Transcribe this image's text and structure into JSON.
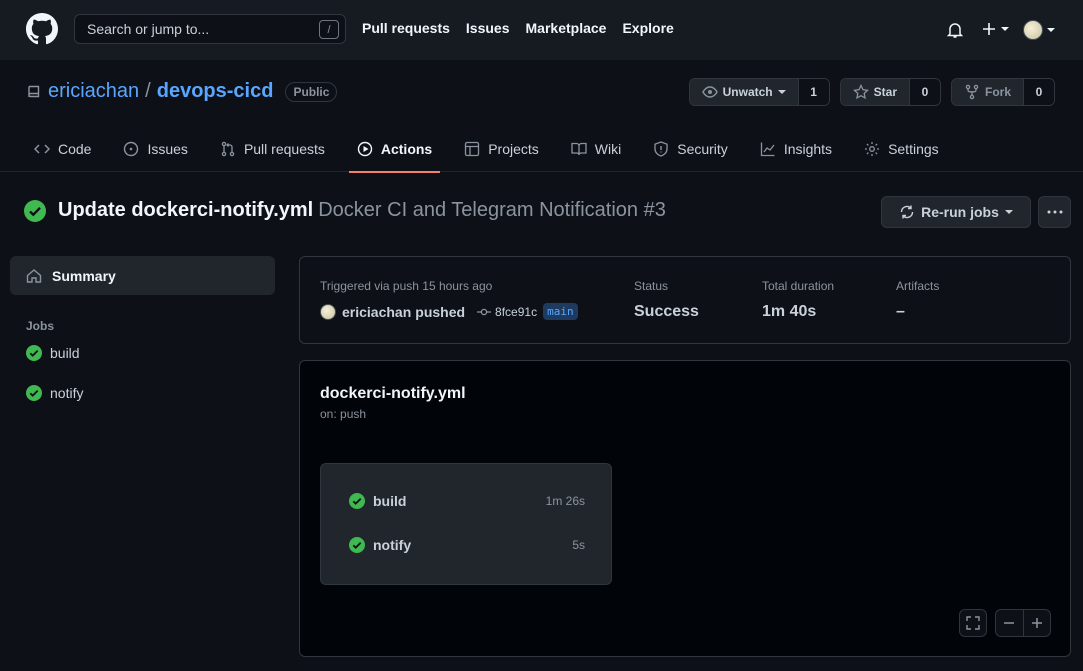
{
  "header": {
    "search_placeholder": "Search or jump to...",
    "search_shortcut": "/",
    "nav": [
      "Pull requests",
      "Issues",
      "Marketplace",
      "Explore"
    ]
  },
  "repo": {
    "owner": "ericiachan",
    "separator": "/",
    "name": "devops-cicd",
    "visibility": "Public",
    "unwatch_label": "Unwatch",
    "watch_count": "1",
    "star_label": "Star",
    "star_count": "0",
    "fork_label": "Fork",
    "fork_count": "0"
  },
  "tabs": [
    {
      "label": "Code",
      "icon": "code-icon"
    },
    {
      "label": "Issues",
      "icon": "issue-icon"
    },
    {
      "label": "Pull requests",
      "icon": "pull-request-icon"
    },
    {
      "label": "Actions",
      "icon": "play-icon",
      "active": true
    },
    {
      "label": "Projects",
      "icon": "table-icon"
    },
    {
      "label": "Wiki",
      "icon": "book-icon"
    },
    {
      "label": "Security",
      "icon": "shield-icon"
    },
    {
      "label": "Insights",
      "icon": "graph-icon"
    },
    {
      "label": "Settings",
      "icon": "gear-icon"
    }
  ],
  "run": {
    "commit_title": "Update dockerci-notify.yml",
    "workflow_label": "Docker CI and Telegram Notification #3",
    "rerun_label": "Re-run jobs"
  },
  "sidebar": {
    "summary_label": "Summary",
    "jobs_heading": "Jobs",
    "jobs": [
      "build",
      "notify"
    ]
  },
  "summary": {
    "trigger_text": "Triggered via push 15 hours ago",
    "actor": "ericiachan",
    "action": "pushed",
    "sha": "8fce91c",
    "branch": "main",
    "status_label": "Status",
    "status_value": "Success",
    "duration_label": "Total duration",
    "duration_value": "1m 40s",
    "artifacts_label": "Artifacts",
    "artifacts_value": "–"
  },
  "graph": {
    "file": "dockerci-notify.yml",
    "trigger": "on: push",
    "jobs": [
      {
        "name": "build",
        "duration": "1m 26s"
      },
      {
        "name": "notify",
        "duration": "5s"
      }
    ]
  },
  "colors": {
    "success": "#3fb950",
    "accent_underline": "#f78166",
    "link": "#58a6ff"
  }
}
